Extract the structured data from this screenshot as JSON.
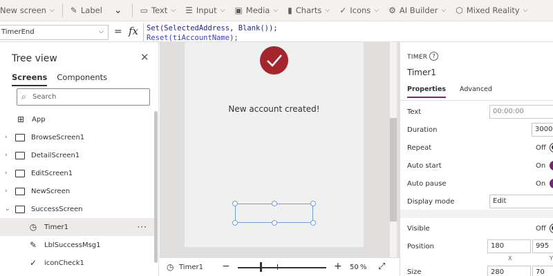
{
  "ribbon": {
    "new_screen": "New screen",
    "label": "Label",
    "text": "Text",
    "input": "Input",
    "media": "Media",
    "charts": "Charts",
    "icons": "Icons",
    "ai_builder": "AI Builder",
    "mixed_reality": "Mixed Reality"
  },
  "formula_bar": {
    "property": "TimerEnd",
    "fx": "fx",
    "line1": "Set(SelectedAddress, Blank());",
    "line2": "Reset(tiAccountName);"
  },
  "tree_view": {
    "title": "Tree view",
    "tabs": [
      "Screens",
      "Components"
    ],
    "search_placeholder": "Search",
    "items": [
      {
        "label": "App"
      },
      {
        "label": "BrowseScreen1"
      },
      {
        "label": "DetailScreen1"
      },
      {
        "label": "EditScreen1"
      },
      {
        "label": "NewScreen"
      },
      {
        "label": "SuccessScreen"
      },
      {
        "label": "Timer1"
      },
      {
        "label": "LblSuccessMsg1"
      },
      {
        "label": "iconCheck1"
      }
    ]
  },
  "canvas": {
    "message": "New account created!",
    "accent_color": "#a4262c"
  },
  "status_bar": {
    "selected": "Timer1",
    "zoom": "50",
    "zoom_unit": "%"
  },
  "properties": {
    "type": "TIMER",
    "name": "Timer1",
    "tabs": [
      "Properties",
      "Advanced"
    ],
    "text_label": "Text",
    "text_value": "00:00:00",
    "duration_label": "Duration",
    "duration_value": "3000",
    "repeat_label": "Repeat",
    "repeat_value": "Off",
    "autostart_label": "Auto start",
    "autostart_value": "On",
    "autopause_label": "Auto pause",
    "autopause_value": "On",
    "displaymode_label": "Display mode",
    "displaymode_value": "Edit",
    "visible_label": "Visible",
    "visible_value": "Off",
    "position_label": "Position",
    "position_x": "180",
    "position_y": "995",
    "x_label": "X",
    "y_label": "Y",
    "size_label": "Size",
    "size_w": "280",
    "size_h": "70",
    "accent_color": "#742774"
  }
}
